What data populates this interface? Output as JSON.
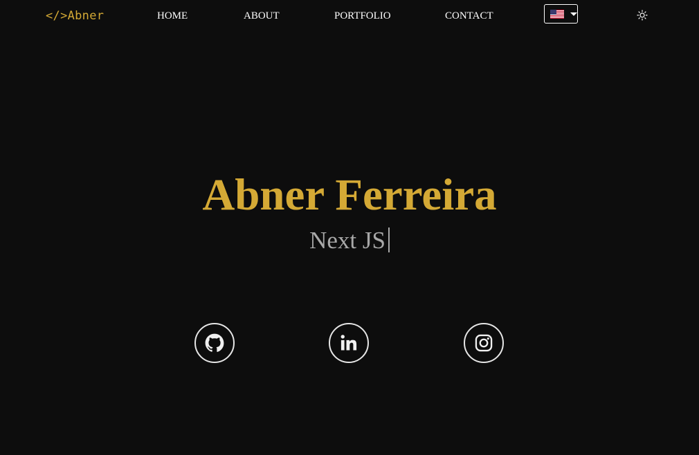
{
  "header": {
    "logo": "</>Abner",
    "nav": [
      {
        "label": "HOME"
      },
      {
        "label": "ABOUT"
      },
      {
        "label": "PORTFOLIO"
      },
      {
        "label": "CONTACT"
      }
    ],
    "language_icon": "us-flag-icon",
    "theme_icon": "sun-icon"
  },
  "hero": {
    "name": "Abner Ferreira",
    "role": "Next JS"
  },
  "social": [
    {
      "icon": "github-icon"
    },
    {
      "icon": "linkedin-icon"
    },
    {
      "icon": "instagram-icon"
    }
  ],
  "colors": {
    "background": "#0d0d0d",
    "accent": "#d4a935",
    "subtitle": "#a8a8a8",
    "text": "#ffffff"
  }
}
